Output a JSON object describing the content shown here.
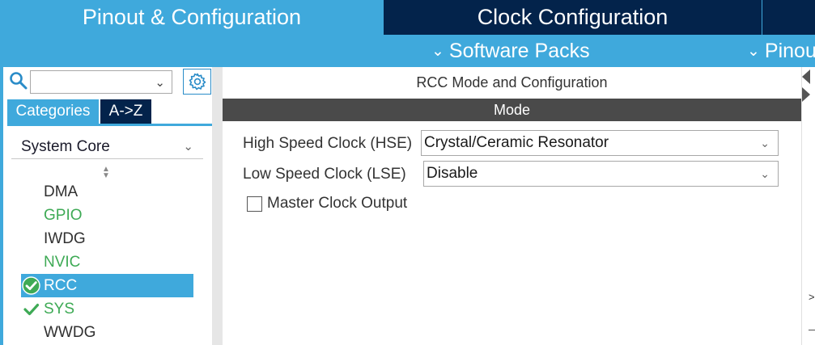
{
  "top_tabs": {
    "pinout": "Pinout & Configuration",
    "clock": "Clock Configuration"
  },
  "subbar": {
    "software_packs": "Software Packs",
    "pinout": "Pinou"
  },
  "sidebar": {
    "search": {
      "value": "",
      "placeholder": ""
    },
    "tabs": {
      "categories": "Categories",
      "az": "A->Z"
    },
    "category": "System Core",
    "items": [
      {
        "label": "DMA",
        "state": "normal"
      },
      {
        "label": "GPIO",
        "state": "configured"
      },
      {
        "label": "IWDG",
        "state": "normal"
      },
      {
        "label": "NVIC",
        "state": "configured"
      },
      {
        "label": "RCC",
        "state": "selected-checked"
      },
      {
        "label": "SYS",
        "state": "checked"
      },
      {
        "label": "WWDG",
        "state": "normal"
      }
    ]
  },
  "main": {
    "title": "RCC Mode and Configuration",
    "section": "Mode",
    "hse": {
      "label": "High Speed Clock (HSE)",
      "value": "Crystal/Ceramic Resonator"
    },
    "lse": {
      "label": "Low Speed Clock (LSE)",
      "value": "Disable"
    },
    "mco": {
      "label": "Master Clock Output",
      "checked": false
    }
  },
  "colors": {
    "accent": "#3fa9dc",
    "dark_navy": "#03234b",
    "configured_green": "#3eaa55",
    "mode_bar": "#4a4a4a"
  },
  "icons": [
    "search-icon",
    "gear-icon",
    "chevron-down-icon",
    "sort-icon",
    "check-circle-icon",
    "check-icon",
    "collapse-arrow-icon",
    "expand-arrow-icon"
  ]
}
